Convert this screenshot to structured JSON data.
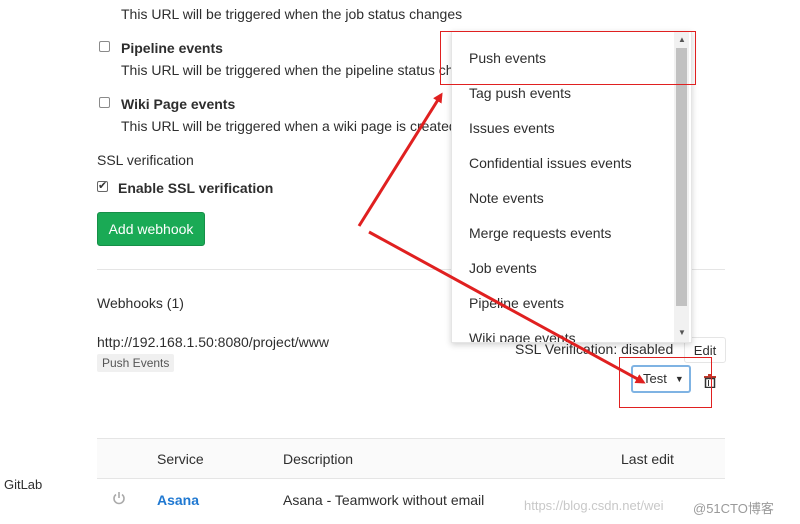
{
  "events": {
    "job_desc": "This URL will be triggered when the job status changes",
    "pipeline_label": "Pipeline events",
    "pipeline_desc": "This URL will be triggered when the pipeline status ch",
    "wiki_label": "Wiki Page events",
    "wiki_desc": "This URL will be triggered when a wiki page is created"
  },
  "ssl": {
    "heading": "SSL verification",
    "checkbox_label": "Enable SSL verification",
    "checked": true
  },
  "add_webhook_label": "Add webhook",
  "webhooks": {
    "heading": "Webhooks (1)",
    "items": [
      {
        "url": "http://192.168.1.50:8080/project/www",
        "tag": "Push Events",
        "ssl_status": "SSL Verification: disabled",
        "edit_label": "Edit",
        "test_label": "Test"
      }
    ]
  },
  "test_dropdown": {
    "items": [
      "Push events",
      "Tag push events",
      "Issues events",
      "Confidential issues events",
      "Note events",
      "Merge requests events",
      "Job events",
      "Pipeline events",
      "Wiki page events"
    ]
  },
  "services_table": {
    "columns": [
      "Service",
      "Description",
      "Last edit"
    ],
    "rows": [
      {
        "service": "Asana",
        "description": "Asana - Teamwork without email"
      }
    ]
  },
  "left_edge_text": "GitLab",
  "watermark": "https://blog.csdn.net/wei",
  "watermark2": "@51CTO博客",
  "colors": {
    "primary_green": "#1aaa55",
    "annotation_red": "#e02020",
    "link_blue": "#1f78d1"
  }
}
